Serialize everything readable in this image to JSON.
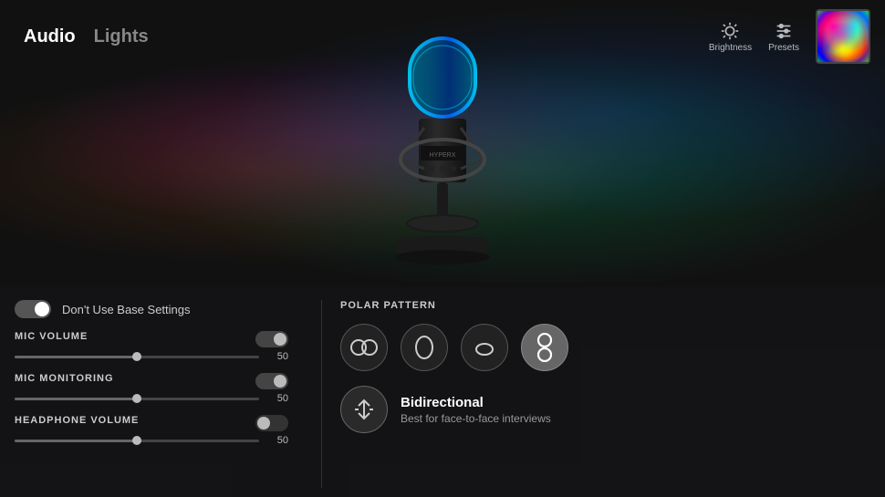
{
  "header": {
    "tabs": [
      {
        "label": "Audio",
        "active": true
      },
      {
        "label": "Lights",
        "active": false
      }
    ],
    "brightness_label": "Brightness",
    "presets_label": "Presets"
  },
  "base_toggle": {
    "label": "Don't Use Base Settings",
    "on": true
  },
  "mic_volume": {
    "label": "MIC VOLUME",
    "value": "50",
    "slider_pct": 50,
    "enabled": true
  },
  "mic_monitoring": {
    "label": "MIC MONITORING",
    "value": "50",
    "slider_pct": 50,
    "enabled": true
  },
  "headphone_volume": {
    "label": "HEADPHONE VOLUME",
    "value": "50",
    "slider_pct": 50,
    "enabled": false
  },
  "polar_pattern": {
    "label": "POLAR PATTERN",
    "patterns": [
      {
        "name": "stereo",
        "active": false
      },
      {
        "name": "cardioid",
        "active": false
      },
      {
        "name": "omnidirectional",
        "active": false
      },
      {
        "name": "bidirectional",
        "active": true
      }
    ],
    "selected": {
      "name": "Bidirectional",
      "description": "Best for face-to-face interviews"
    }
  }
}
